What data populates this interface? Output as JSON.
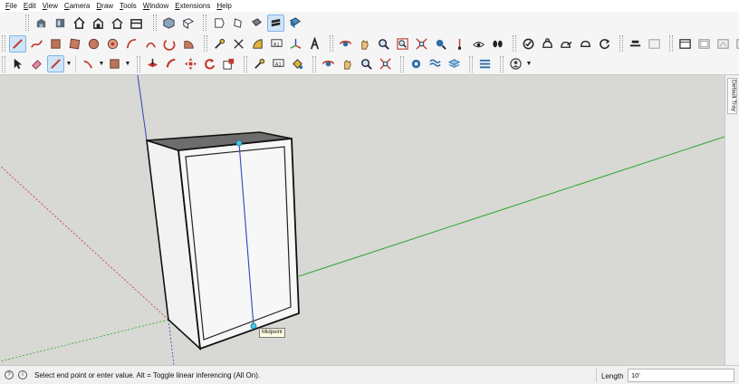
{
  "menu": [
    "File",
    "Edit",
    "View",
    "Camera",
    "Draw",
    "Tools",
    "Window",
    "Extensions",
    "Help"
  ],
  "toolbars": {
    "row1": [
      "new-file-icon",
      "open-file-icon",
      "home-icon",
      "save-icon",
      "house-outline-icon",
      "warehouse-icon",
      "iso-view-icon",
      "top-view-icon",
      "front-view-icon",
      "right-view-icon",
      "back-view-icon",
      "left-view-icon",
      "xray-icon",
      "shaded-icon"
    ],
    "row2": [
      "line-icon",
      "freehand-icon",
      "rectangle-icon",
      "rotated-rectangle-icon",
      "circle-icon",
      "polygon-icon",
      "arc-icon",
      "two-point-arc-icon",
      "three-point-arc-icon",
      "pie-icon",
      "tape-measure-icon",
      "dimension-icon",
      "protractor-icon",
      "text-icon",
      "axes-icon",
      "3d-text-icon",
      "orbit-icon",
      "pan-icon",
      "zoom-icon",
      "zoom-window-icon",
      "zoom-extents-icon",
      "position-camera-icon",
      "look-around-icon",
      "walk-icon",
      "section-plane-icon",
      "sandbox-icon",
      "smoove-icon",
      "stamp-icon",
      "drape-icon",
      "add-detail-icon",
      "flip-edge-icon",
      "display-section-icon",
      "display-cuts-icon",
      "window-icon",
      "styles-icon",
      "shadows-icon",
      "lock-icon"
    ],
    "row3": [
      "select-icon",
      "eraser-icon",
      "pencil-icon",
      "arc-tool-icon",
      "shape-tool-icon",
      "push-pull-icon",
      "follow-me-icon",
      "move-icon",
      "rotate-icon",
      "scale-icon",
      "tape-icon",
      "label-icon",
      "paint-bucket-icon",
      "orbit-icon-2",
      "pan-icon-2",
      "zoom-icon-2",
      "zoom-extents-icon-2",
      "warehouse-icon-2",
      "extension-warehouse-icon",
      "layout-icon",
      "extension-manager-icon",
      "account-icon"
    ]
  },
  "viewport": {
    "tooltip": "Midpoint",
    "axis_colors": {
      "red": "#cc3333",
      "green": "#2ea82e",
      "blue": "#3344bb"
    },
    "background": "#d8d8d4"
  },
  "tray": {
    "label": "Default Tray"
  },
  "status": {
    "message": "Select end point or enter value. Alt = Toggle linear inferencing (All On).",
    "measurement_label": "Length",
    "measurement_value": "10'"
  }
}
